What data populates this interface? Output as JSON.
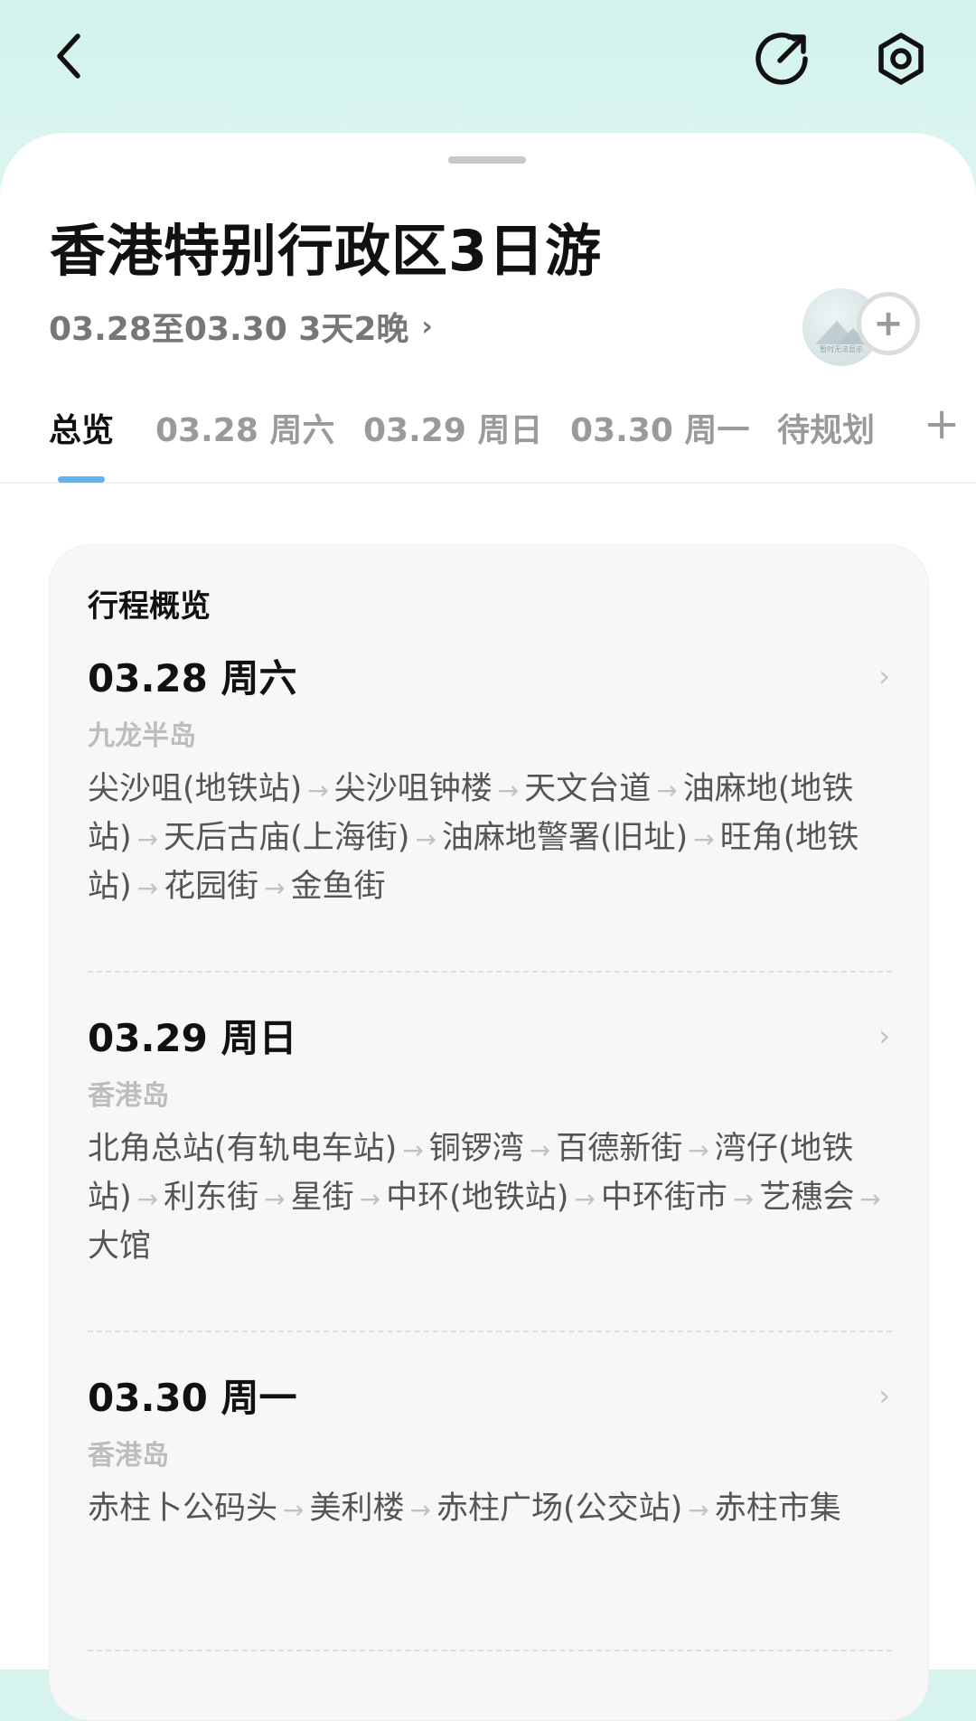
{
  "header": {
    "back_icon": "back-arrow-icon",
    "share_icon": "share-icon",
    "settings_icon": "settings-icon"
  },
  "trip": {
    "title": "香港特别行政区3日游",
    "dates": "03.28至03.30 3天2晚",
    "avatar_caption": "暂时无法显示"
  },
  "tabs": [
    "总览",
    "03.28 周六",
    "03.29 周日",
    "03.30 周一",
    "待规划"
  ],
  "overview": {
    "title": "行程概览",
    "days": [
      {
        "date": "03.28 周六",
        "area": "九龙半岛",
        "stops": [
          "尖沙咀(地铁站)",
          "尖沙咀钟楼",
          "天文台道",
          "油麻地(地铁站)",
          "天后古庙(上海街)",
          "油麻地警署(旧址)",
          "旺角(地铁站)",
          "花园街",
          "金鱼街"
        ]
      },
      {
        "date": "03.29 周日",
        "area": "香港岛",
        "stops": [
          "北角总站(有轨电车站)",
          "铜锣湾",
          "百德新街",
          "湾仔(地铁站)",
          "利东街",
          "星街",
          "中环(地铁站)",
          "中环街市",
          "艺穗会",
          "大馆"
        ]
      },
      {
        "date": "03.30 周一",
        "area": "香港岛",
        "stops": [
          "赤柱卜公码头",
          "美利楼",
          "赤柱广场(公交站)",
          "赤柱市集"
        ]
      }
    ]
  }
}
